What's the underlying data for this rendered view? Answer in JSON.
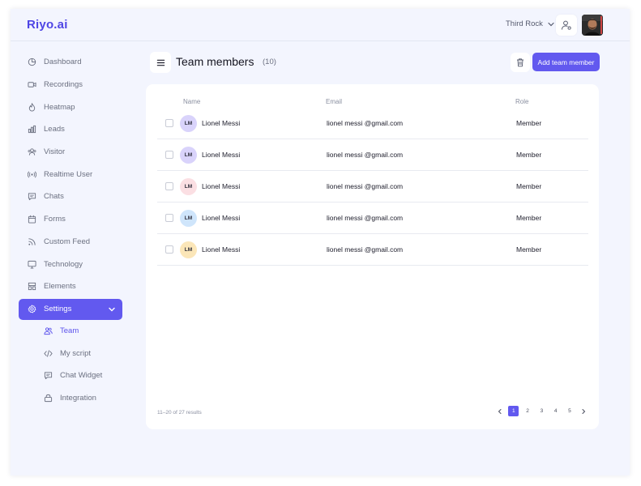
{
  "app": {
    "logo": "Riyo.ai"
  },
  "topbar": {
    "workspace": "Third Rock"
  },
  "sidebar": {
    "items": [
      {
        "label": "Dashboard",
        "icon": "pie-chart-icon"
      },
      {
        "label": "Recordings",
        "icon": "video-icon"
      },
      {
        "label": "Heatmap",
        "icon": "fire-icon"
      },
      {
        "label": "Leads",
        "icon": "bar-chart-icon"
      },
      {
        "label": "Visitor",
        "icon": "users-icon"
      },
      {
        "label": "Realtime User",
        "icon": "broadcast-icon"
      },
      {
        "label": "Chats",
        "icon": "chat-icon"
      },
      {
        "label": "Forms",
        "icon": "calendar-icon"
      },
      {
        "label": "Custom Feed",
        "icon": "rss-icon"
      },
      {
        "label": "Technology",
        "icon": "monitor-icon"
      },
      {
        "label": "Elements",
        "icon": "layout-icon"
      }
    ],
    "settings": {
      "label": "Settings",
      "icon": "gear-icon"
    },
    "subitems": [
      {
        "label": "Team",
        "icon": "team-icon"
      },
      {
        "label": "My script",
        "icon": "code-icon"
      },
      {
        "label": "Chat Widget",
        "icon": "chat-widget-icon"
      },
      {
        "label": "Integration",
        "icon": "integration-icon"
      }
    ]
  },
  "header": {
    "title": "Team members",
    "count": "(10)",
    "add_button": "Add team member"
  },
  "table": {
    "columns": [
      "Name",
      "Email",
      "Role"
    ],
    "rows": [
      {
        "initials": "LM",
        "name": "Lionel Messi",
        "email": "lionel messi @gmail.com",
        "role": "Member",
        "avatar_color": "#d9d3fb"
      },
      {
        "initials": "LM",
        "name": "Lionel Messi",
        "email": "lionel messi @gmail.com",
        "role": "Member",
        "avatar_color": "#d9d3fb"
      },
      {
        "initials": "LM",
        "name": "Lionel Messi",
        "email": "lionel messi @gmail.com",
        "role": "Member",
        "avatar_color": "#fbdfe3"
      },
      {
        "initials": "LM",
        "name": "Lionel Messi",
        "email": "lionel messi @gmail.com",
        "role": "Member",
        "avatar_color": "#cfe5fb"
      },
      {
        "initials": "LM",
        "name": "Lionel Messi",
        "email": "lionel messi @gmail.com",
        "role": "Member",
        "avatar_color": "#fbe6b8"
      }
    ]
  },
  "pagination": {
    "results": "11–20 of 27 results",
    "pages": [
      "1",
      "2",
      "3",
      "4",
      "5"
    ],
    "current": "1"
  },
  "colors": {
    "accent": "#6259ef",
    "background": "#f3f5fe"
  }
}
